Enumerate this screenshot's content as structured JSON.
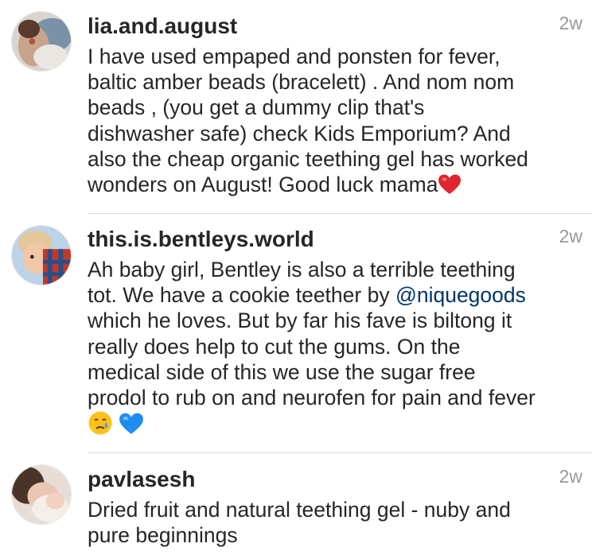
{
  "comments": [
    {
      "username": "lia.and.august",
      "time": "2w",
      "text": "I have used empaped and ponsten for fever,\nbaltic amber beads (bracelett) . And nom nom\nbeads , (you get a dummy clip that's\ndishwasher safe) check Kids Emporium? And\nalso the cheap organic teething gel has worked\nwonders on August! Good luck mama",
      "trailing_emoji": "red-heart"
    },
    {
      "username": "this.is.bentleys.world",
      "time": "2w",
      "text_before": "Ah baby girl, Bentley is also a terrible teething\ntot. We have a cookie teether by ",
      "mention": "@niquegoods",
      "text_after": "\nwhich he loves. But by far his fave is biltong it\nreally does help to cut the gums. On the\nmedical side of this we use the sugar free\nprodol to rub on and neurofen for pain and fever",
      "trailing_emojis": [
        "crying-face",
        "blue-heart"
      ]
    },
    {
      "username": "pavlasesh",
      "time": "2w",
      "text": "Dried fruit and natural teething gel - nuby and\npure beginnings"
    }
  ],
  "colors": {
    "username": "#262626",
    "text": "#262626",
    "time": "#999999",
    "mention": "#003569",
    "divider": "#dbdbdb"
  }
}
